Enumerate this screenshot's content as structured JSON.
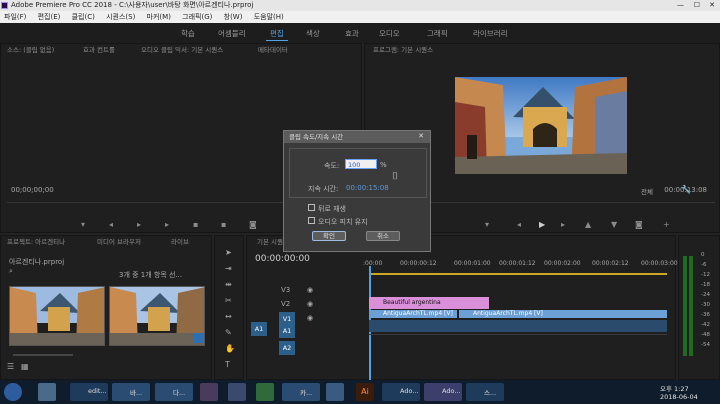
{
  "window": {
    "title": "Adobe Premiere Pro CC 2018 - C:\\사용자\\user\\바탕 화면\\아르겐티나.prproj"
  },
  "menu": [
    "파일(F)",
    "편집(E)",
    "클립(C)",
    "시퀀스(S)",
    "마커(M)",
    "그래픽(G)",
    "창(W)",
    "도움말(H)"
  ],
  "workspaces": {
    "items": [
      "학습",
      "어셈블리",
      "편집",
      "색상",
      "효과",
      "오디오",
      "그래픽",
      "라이브러리"
    ],
    "active": "편집"
  },
  "source_panel": {
    "tabs": [
      "소스: (클립 없음)",
      "효과 컨트롤",
      "오디오 클립 믹서: 기본 시퀀스",
      "메타데이터"
    ],
    "timecode": "00;00;00;00"
  },
  "program_panel": {
    "tab": "프로그램: 기본 시퀀스",
    "fit": "전체",
    "timecode": "00:00:13:08"
  },
  "dialog": {
    "title": "클립 속도/지속 시간",
    "speed_label": "속도:",
    "speed_value": "100",
    "speed_unit": "%",
    "duration_label": "지속 시간:",
    "duration_value": "00:00:15:08",
    "reverse_label": "뒤로 재생",
    "pitch_label": "오디오 피치 유지",
    "ok": "확인",
    "cancel": "취소"
  },
  "project_panel": {
    "tabs": [
      "프로젝트: 아르겐티나",
      "미디어 브라우저",
      "라이브"
    ],
    "name": "아르겐티나.prproj",
    "count": "3개 중 1개 항목 선..."
  },
  "timeline": {
    "tab": "기본 시퀀스",
    "timecode": "00:00:00:00",
    "ruler": [
      ":00:00",
      "00:00:00:12",
      "00:00:01:00",
      "00:00:01:12",
      "00:00:02:00",
      "00:00:02:12",
      "00:00:03:00"
    ],
    "tracks": [
      "V3",
      "V2",
      "V1",
      "A1",
      "A2"
    ],
    "clips": {
      "title": "Beautiful argentina",
      "v1a": "AntiguaArchTL.mp4 [V]",
      "v1b": "AntiguaArchTL.mp4 [V]"
    }
  },
  "meter_labels": [
    "0",
    "-6",
    "-12",
    "-18",
    "-24",
    "-30",
    "-36",
    "-42",
    "-48",
    "-54"
  ],
  "taskbar": {
    "items": [
      "edit...",
      "바...",
      "다...",
      "",
      "",
      "카...",
      "",
      "",
      "Ai",
      "Ado...",
      "Ado...",
      "스..."
    ],
    "time": "오후 1:27",
    "date": "2018-06-04"
  }
}
